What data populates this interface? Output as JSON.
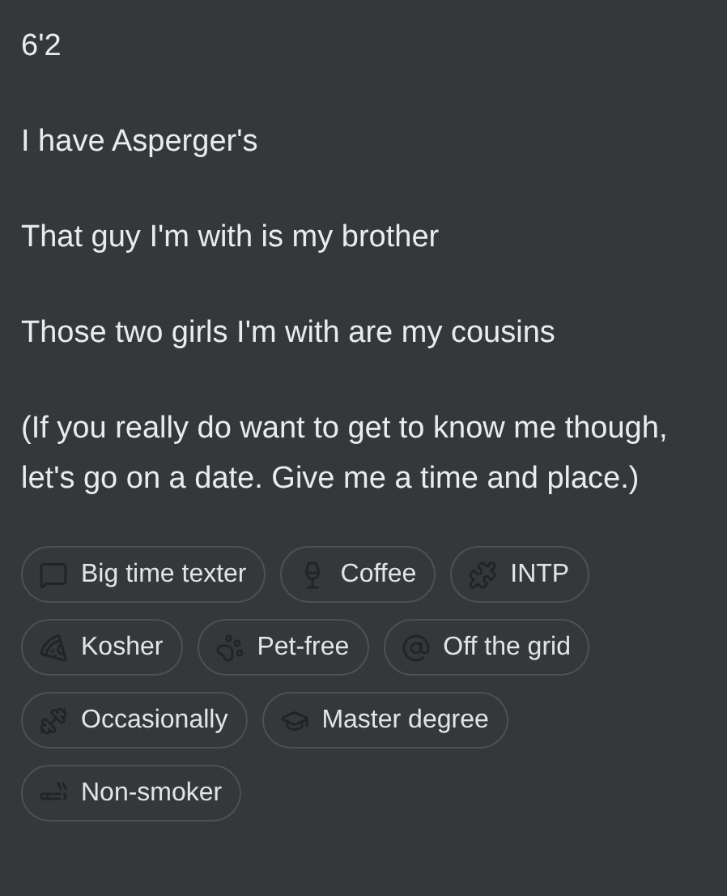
{
  "paragraphs": [
    "6'2",
    "I have Asperger's",
    "That guy I'm with is my brother",
    "Those two girls I'm with are my cousins",
    "(If you really do want to get to know me though, let's go on a date. Give me a time and place.)"
  ],
  "tags": [
    {
      "label": "Big time texter",
      "kind": "chat"
    },
    {
      "label": "Coffee",
      "kind": "glass"
    },
    {
      "label": "INTP",
      "kind": "puzzle"
    },
    {
      "label": "Kosher",
      "kind": "pizza"
    },
    {
      "label": "Pet-free",
      "kind": "paw"
    },
    {
      "label": "Off the grid",
      "kind": "at"
    },
    {
      "label": "Occasionally",
      "kind": "dumbbell"
    },
    {
      "label": "Master degree",
      "kind": "cap"
    },
    {
      "label": "Non-smoker",
      "kind": "cigarette"
    }
  ]
}
